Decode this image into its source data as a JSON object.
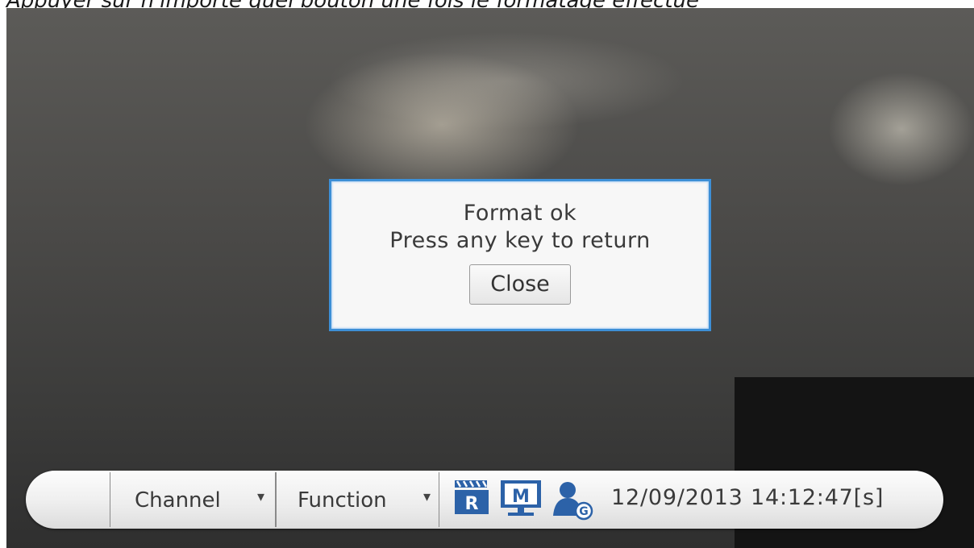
{
  "caption": "Appuyer sur n'importe quel bouton une fois le formatage effectué",
  "dialog": {
    "line1": "Format ok",
    "line2": "Press any key to return",
    "close_label": "Close"
  },
  "taskbar": {
    "menus": [
      {
        "label": "Channel",
        "arrow": "▾"
      },
      {
        "label": "Function",
        "arrow": "▾"
      }
    ],
    "icons": {
      "record": {
        "name": "record-icon",
        "letter": "R"
      },
      "monitor": {
        "name": "monitor-icon",
        "letter": "M"
      },
      "user": {
        "name": "user-icon",
        "letter": "G"
      }
    },
    "datetime": "12/09/2013 14:12:47[s]"
  },
  "colors": {
    "dialog_border": "#3d8fd6",
    "icon_blue": "#2c62a8"
  }
}
